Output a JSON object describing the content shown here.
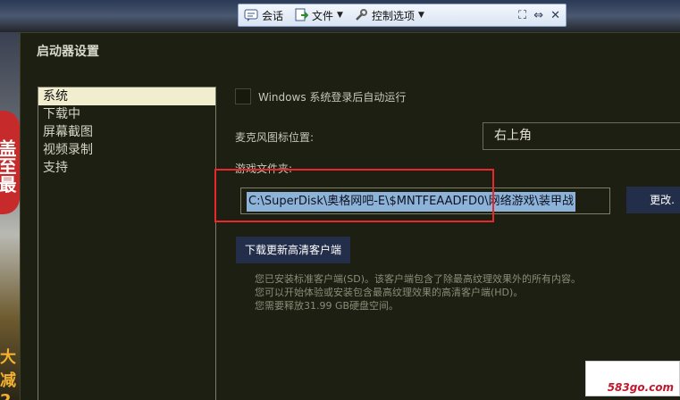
{
  "toolbar": {
    "chat_label": "会话",
    "file_label": "文件",
    "control_label": "控制选项"
  },
  "dialog": {
    "title": "启动器设置"
  },
  "sidebar": {
    "items": [
      {
        "label": "系统",
        "active": true
      },
      {
        "label": "下载中",
        "active": false
      },
      {
        "label": "屏幕截图",
        "active": false
      },
      {
        "label": "视频录制",
        "active": false
      },
      {
        "label": "支持",
        "active": false
      }
    ]
  },
  "system": {
    "autostart_label": "Windows 系统登录后自动运行",
    "autostart_checked": false,
    "mic_label": "麦克风图标位置:",
    "mic_value": "右上角",
    "folder_label": "游戏文件夹:",
    "folder_path": "C:\\SuperDisk\\奥格网吧-E\\$MNTFEAADFD0\\网络游戏\\装甲战",
    "change_button": "更改.",
    "download_button": "下载更新高清客户端",
    "info_lines": [
      "您已安装标准客户端(SD)。该客户端包含了除最高纹理效果外的所有内容。",
      "您可以开始体验或安装包含最高纹理效果的高清客户端(HD)。",
      "您需要释放31.99 GB硬盘空间。"
    ]
  },
  "background": {
    "badge_text": "盖至最",
    "gold_text": "大减2"
  },
  "watermark": {
    "text": "583go.com"
  },
  "colors": {
    "dialog_bg": "#1c1f11",
    "button_bg": "#232f4a",
    "highlight": "#e8282c",
    "selection": "#8eb3d9"
  }
}
